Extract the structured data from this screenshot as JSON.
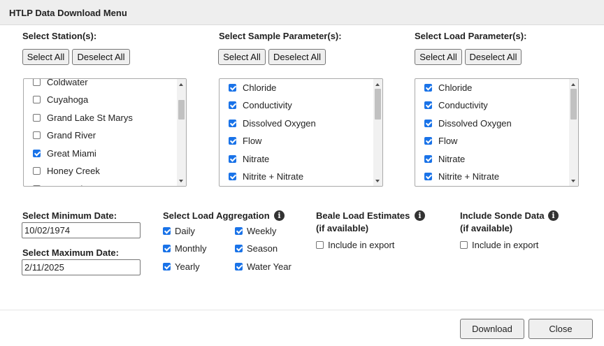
{
  "header": {
    "title": "HTLP Data Download Menu"
  },
  "stations": {
    "title": "Select Station(s):",
    "select_all": "Select All",
    "deselect_all": "Deselect All",
    "items": [
      {
        "label": "Coldwater",
        "checked": false
      },
      {
        "label": "Cuyahoga",
        "checked": false
      },
      {
        "label": "Grand Lake St Marys",
        "checked": false
      },
      {
        "label": "Grand River",
        "checked": false
      },
      {
        "label": "Great Miami",
        "checked": true
      },
      {
        "label": "Honey Creek",
        "checked": false
      },
      {
        "label": "Huron River",
        "checked": false
      }
    ]
  },
  "sample_params": {
    "title": "Select Sample Parameter(s):",
    "select_all": "Select All",
    "deselect_all": "Deselect All",
    "items": [
      {
        "label": "Chloride",
        "checked": true
      },
      {
        "label": "Conductivity",
        "checked": true
      },
      {
        "label": "Dissolved Oxygen",
        "checked": true
      },
      {
        "label": "Flow",
        "checked": true
      },
      {
        "label": "Nitrate",
        "checked": true
      },
      {
        "label": "Nitrite + Nitrate",
        "checked": true
      }
    ]
  },
  "load_params": {
    "title": "Select Load Parameter(s):",
    "select_all": "Select All",
    "deselect_all": "Deselect All",
    "items": [
      {
        "label": "Chloride",
        "checked": true
      },
      {
        "label": "Conductivity",
        "checked": true
      },
      {
        "label": "Dissolved Oxygen",
        "checked": true
      },
      {
        "label": "Flow",
        "checked": true
      },
      {
        "label": "Nitrate",
        "checked": true
      },
      {
        "label": "Nitrite + Nitrate",
        "checked": true
      }
    ]
  },
  "dates": {
    "min_label": "Select Minimum Date:",
    "min_value": "10/02/1974",
    "max_label": "Select Maximum Date:",
    "max_value": "2/11/2025"
  },
  "aggregation": {
    "title": "Select Load Aggregation",
    "options": [
      {
        "label": "Daily",
        "checked": true
      },
      {
        "label": "Weekly",
        "checked": true
      },
      {
        "label": "Monthly",
        "checked": true
      },
      {
        "label": "Season",
        "checked": true
      },
      {
        "label": "Yearly",
        "checked": true
      },
      {
        "label": "Water Year",
        "checked": true
      }
    ]
  },
  "beale": {
    "title": "Beale Load Estimates",
    "subtitle": "(if available)",
    "option": "Include in export",
    "checked": false
  },
  "sonde": {
    "title": "Include Sonde Data",
    "subtitle": "(if available)",
    "option": "Include in export",
    "checked": false
  },
  "footer": {
    "download": "Download",
    "close": "Close"
  },
  "colors": {
    "checkbox_checked": "#1a73e8",
    "header_bg": "#eeeeee"
  }
}
